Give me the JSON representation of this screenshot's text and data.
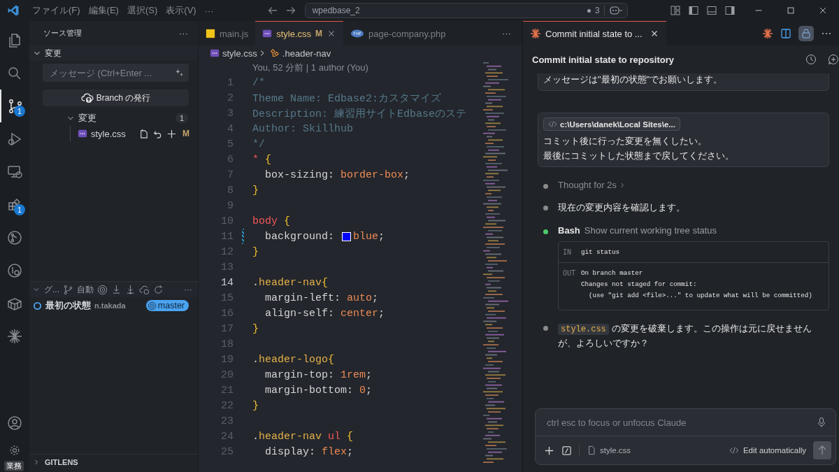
{
  "title_bar": {
    "menus": [
      "ファイル(F)",
      "編集(E)",
      "選択(S)",
      "表示(V)"
    ],
    "more": "···",
    "search": "wpedbase_2",
    "problems": "3"
  },
  "activity_bar": {
    "top": [
      {
        "kind": "files",
        "selected": false
      },
      {
        "kind": "search",
        "selected": false
      },
      {
        "kind": "scm",
        "selected": true,
        "badge": "1"
      },
      {
        "kind": "debug",
        "selected": false
      },
      {
        "kind": "remote",
        "selected": false
      },
      {
        "kind": "extensions",
        "selected": false,
        "badge": "1"
      },
      {
        "kind": "gitlens",
        "selected": false
      },
      {
        "kind": "inspect",
        "selected": false
      },
      {
        "kind": "containers",
        "selected": false
      },
      {
        "kind": "spark",
        "selected": false
      }
    ],
    "bottom": [
      {
        "kind": "account"
      },
      {
        "kind": "settings",
        "label": "業務"
      }
    ]
  },
  "sidebar": {
    "title": "ソース管理",
    "more": "···",
    "changes_section": {
      "title": "変更",
      "expanded": true
    },
    "message": {
      "placeholder": "メッセージ (Ctrl+Enter ..."
    },
    "publish_button": "Branch の発行",
    "group": {
      "title": "変更",
      "count": "1",
      "expanded": true
    },
    "files": [
      {
        "name": "style.css",
        "status": "M"
      }
    ],
    "graph_section": {
      "title": "グ...",
      "mode": "自動",
      "more": "···",
      "expanded": true
    },
    "commits": [
      {
        "message": "最初の状態",
        "author": "n.takada",
        "branch": "master"
      }
    ],
    "gitlens_section": {
      "title": "GITLENS",
      "expanded": false
    }
  },
  "editor": {
    "tabs": [
      {
        "label": "main.js",
        "kind": "js",
        "selected": false
      },
      {
        "label": "style.css",
        "kind": "css",
        "selected": true,
        "status": "M"
      },
      {
        "label": "page-company.php",
        "kind": "php",
        "selected": false
      }
    ],
    "more": "···",
    "breadcrumb": [
      {
        "label": "style.css",
        "kind": "css"
      },
      {
        "label": ".header-nav",
        "kind": "selector"
      }
    ],
    "blame": "You, 52 分前 | 1 author (You)",
    "lines": [
      {
        "no": "1",
        "current": false,
        "modified": false,
        "tokens": [
          {
            "kind": "comment",
            "text": "/*"
          }
        ]
      },
      {
        "no": "2",
        "current": false,
        "modified": false,
        "tokens": [
          {
            "kind": "comment",
            "text": "Theme Name: Edbase2:カスタマイズ"
          }
        ]
      },
      {
        "no": "3",
        "current": false,
        "modified": false,
        "tokens": [
          {
            "kind": "comment",
            "text": "Description: 練習用サイトEdbaseのステ"
          }
        ]
      },
      {
        "no": "4",
        "current": false,
        "modified": false,
        "tokens": [
          {
            "kind": "comment",
            "text": "Author: Skillhub"
          }
        ]
      },
      {
        "no": "5",
        "current": false,
        "modified": false,
        "tokens": [
          {
            "kind": "comment",
            "text": "*/"
          }
        ]
      },
      {
        "no": "6",
        "current": false,
        "modified": false,
        "tokens": [
          {
            "kind": "tag",
            "text": "*"
          },
          {
            "kind": "brace",
            "text": " {"
          }
        ]
      },
      {
        "no": "7",
        "current": false,
        "modified": false,
        "tokens": [
          {
            "kind": "plain",
            "text": "  box-sizing: "
          },
          {
            "kind": "value",
            "text": "border-box"
          },
          {
            "kind": "plain",
            "text": ";"
          }
        ]
      },
      {
        "no": "8",
        "current": false,
        "modified": false,
        "tokens": [
          {
            "kind": "brace",
            "text": "}"
          }
        ]
      },
      {
        "no": "9",
        "current": false,
        "modified": false
      },
      {
        "no": "10",
        "current": false,
        "modified": false,
        "tokens": [
          {
            "kind": "tag",
            "text": "body"
          },
          {
            "kind": "brace",
            "text": " {"
          }
        ]
      },
      {
        "no": "11",
        "current": false,
        "modified": true,
        "tokens": [
          {
            "kind": "plain",
            "text": "  background: "
          },
          {
            "kind": "swatch",
            "color": "#0000ff"
          },
          {
            "kind": "value",
            "text": "blue"
          },
          {
            "kind": "plain",
            "text": ";"
          }
        ]
      },
      {
        "no": "12",
        "current": false,
        "modified": false,
        "tokens": [
          {
            "kind": "brace",
            "text": "}"
          }
        ]
      },
      {
        "no": "13",
        "current": false,
        "modified": false
      },
      {
        "no": "14",
        "current": true,
        "modified": false,
        "tokens": [
          {
            "kind": "plain",
            "text": "."
          },
          {
            "kind": "class",
            "text": "header-nav"
          },
          {
            "kind": "brace",
            "text": "{"
          }
        ]
      },
      {
        "no": "15",
        "current": false,
        "modified": false,
        "tokens": [
          {
            "kind": "plain",
            "text": "  margin-left: "
          },
          {
            "kind": "value",
            "text": "auto"
          },
          {
            "kind": "plain",
            "text": ";"
          }
        ]
      },
      {
        "no": "16",
        "current": false,
        "modified": false,
        "tokens": [
          {
            "kind": "plain",
            "text": "  align-self: "
          },
          {
            "kind": "value",
            "text": "center"
          },
          {
            "kind": "plain",
            "text": ";"
          }
        ]
      },
      {
        "no": "17",
        "current": false,
        "modified": false,
        "tokens": [
          {
            "kind": "brace",
            "text": "}"
          }
        ]
      },
      {
        "no": "18",
        "current": false,
        "modified": false
      },
      {
        "no": "19",
        "current": false,
        "modified": false,
        "tokens": [
          {
            "kind": "plain",
            "text": "."
          },
          {
            "kind": "class",
            "text": "header-logo"
          },
          {
            "kind": "brace",
            "text": "{"
          }
        ]
      },
      {
        "no": "20",
        "current": false,
        "modified": false,
        "tokens": [
          {
            "kind": "plain",
            "text": "  margin-top: "
          },
          {
            "kind": "value",
            "text": "1rem"
          },
          {
            "kind": "plain",
            "text": ";"
          }
        ]
      },
      {
        "no": "21",
        "current": false,
        "modified": false,
        "tokens": [
          {
            "kind": "plain",
            "text": "  margin-bottom: "
          },
          {
            "kind": "value",
            "text": "0"
          },
          {
            "kind": "plain",
            "text": ";"
          }
        ]
      },
      {
        "no": "22",
        "current": false,
        "modified": false,
        "tokens": [
          {
            "kind": "brace",
            "text": "}"
          }
        ]
      },
      {
        "no": "23",
        "current": false,
        "modified": false
      },
      {
        "no": "24",
        "current": false,
        "modified": false,
        "tokens": [
          {
            "kind": "plain",
            "text": "."
          },
          {
            "kind": "class",
            "text": "header-nav"
          },
          {
            "kind": "tag",
            "text": " ul"
          },
          {
            "kind": "brace",
            "text": " {"
          }
        ]
      },
      {
        "no": "25",
        "current": false,
        "modified": false,
        "tokens": [
          {
            "kind": "plain",
            "text": "  display: "
          },
          {
            "kind": "value",
            "text": "flex"
          },
          {
            "kind": "plain",
            "text": ";"
          }
        ]
      }
    ]
  },
  "chat": {
    "tab": {
      "label": "Commit initial state to ...",
      "selected": true
    },
    "title": "Commit initial state to repository",
    "messages": [
      {
        "lines": [
          "メッセージは\"最初の状態\"でお願いします。"
        ]
      },
      {
        "context": "c:\\Users\\danek\\Local Sites\\e...",
        "lines": [
          "コミット後に行った変更を無くしたい。",
          "最後にコミットした状態まで戻してください。"
        ]
      }
    ],
    "steps": [
      {
        "kind": "thought",
        "color": "#8a8a8a",
        "text": "Thought for 2s"
      },
      {
        "kind": "text",
        "color": "#8a8a8a",
        "text": "現在の変更内容を確認します。"
      },
      {
        "kind": "tool",
        "color": "#4ec96b",
        "tool": "Bash",
        "text": "Show current working tree status",
        "in_label": "IN",
        "input": "git status",
        "out_label": "OUT",
        "output": [
          "On branch master",
          "Changes not staged for commit:",
          "  (use \"git add <file>...\" to update what will be committed)"
        ]
      },
      {
        "kind": "mixed",
        "color": "#8a8a8a",
        "parts": [
          {
            "kind": "code",
            "text": "style.css"
          },
          {
            "kind": "text",
            "text": "の変更を破棄します。この操作は元に戻せませんが、よろしいですか？"
          }
        ]
      }
    ],
    "input": {
      "placeholder": "ctrl esc to focus or unfocus Claude",
      "file": "style.css",
      "mode": "Edit automatically",
      "send_disabled": true
    }
  }
}
